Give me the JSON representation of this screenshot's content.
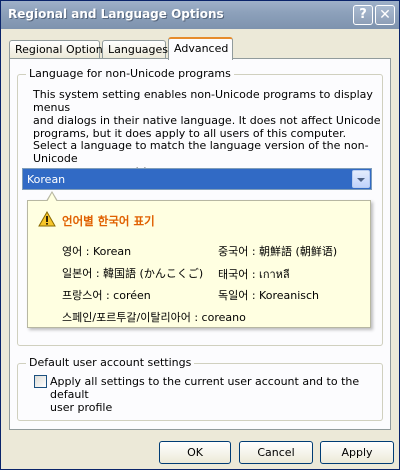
{
  "window": {
    "title": "Regional and Language Options"
  },
  "tabs": [
    {
      "label": "Regional Options"
    },
    {
      "label": "Languages"
    },
    {
      "label": "Advanced"
    }
  ],
  "non_unicode": {
    "legend": "Language for non-Unicode programs",
    "desc_lines": [
      "This system setting enables non-Unicode programs to display menus",
      "and dialogs in their native language. It does not affect Unicode",
      "programs, but it does apply to all users of this computer."
    ],
    "select_lines": [
      "Select a language to match the language version of the non-Unicode",
      "programs you want to use:"
    ],
    "language": "Korean"
  },
  "tooltip": {
    "title": "언어별 한국어 표기",
    "entries": [
      "영어 : Korean",
      "중국어 : 朝鮮語 (朝鲜语)",
      "일본어 : 韓国語 (かんこくご)",
      "태국어 : เกาหลี",
      "프랑스어 : coréen",
      "독일어 : Koreanisch",
      "스페인/포르투갈/이탈리아어 : coreano"
    ]
  },
  "default_user": {
    "legend": "Default user account settings",
    "checkbox_lines": [
      "Apply all settings to the current user account and to the default",
      "user profile"
    ],
    "checked": false
  },
  "buttons": {
    "ok": "OK",
    "cancel": "Cancel",
    "apply": "Apply"
  },
  "colors": {
    "accent": "#316ac5",
    "warning": "#e06000",
    "tooltip_bg": "#ffffe1"
  },
  "icons": {
    "help": "help-icon",
    "close": "close-icon",
    "warning": "warning-icon",
    "dropdown": "chevron-down-icon"
  }
}
